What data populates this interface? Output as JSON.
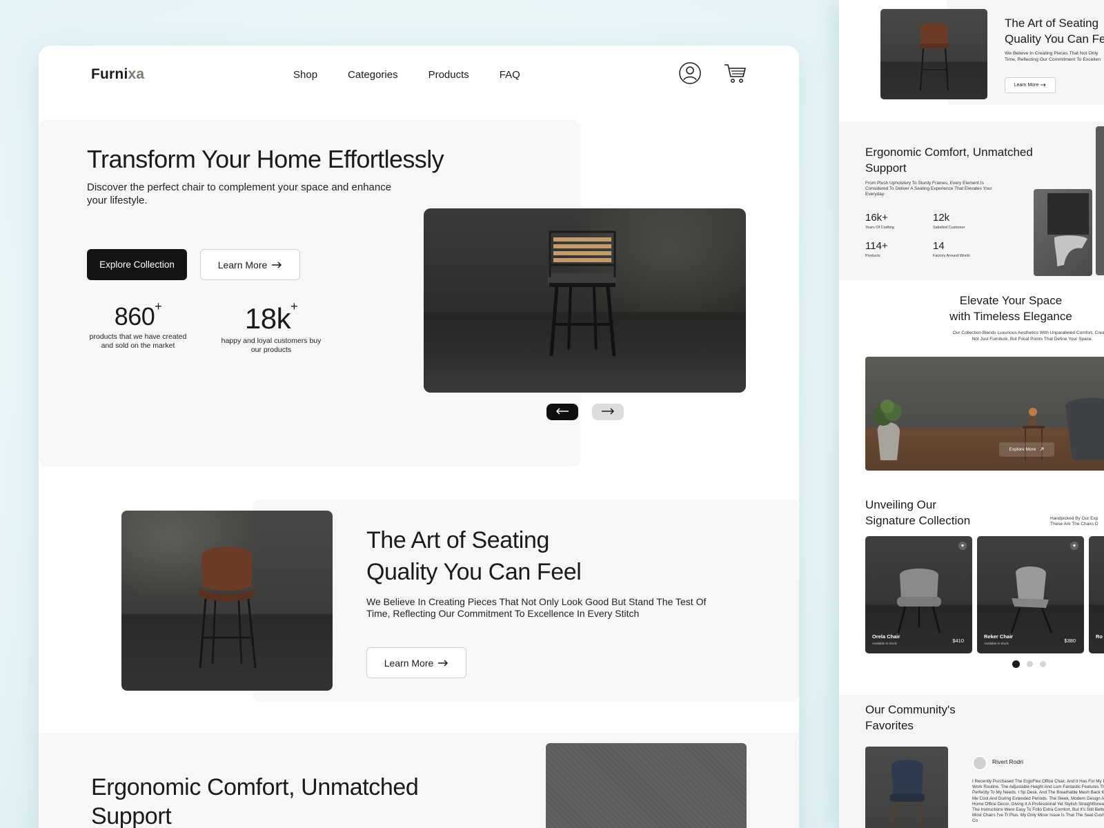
{
  "main": {
    "logo": {
      "part1": "Furni",
      "part2": "xa"
    },
    "nav": [
      "Shop",
      "Categories",
      "Products",
      "FAQ"
    ],
    "icons": {
      "user": "user-circle-icon",
      "cart": "shopping-cart-icon"
    },
    "hero": {
      "title": "Transform Your Home Effortlessly",
      "subtitle": "Discover the perfect chair to complement your space and enhance your lifestyle.",
      "primary_cta": "Explore Collection",
      "secondary_cta": "Learn More",
      "stats": [
        {
          "value": "860",
          "suffix": "+",
          "caption": "products that we have created and sold on the market"
        },
        {
          "value": "18k",
          "suffix": "+",
          "caption": "happy and loyal customers buy our products"
        }
      ]
    },
    "art": {
      "title_line1": "The Art of Seating",
      "title_line2": "Quality You Can Feel",
      "description": "We Believe In Creating Pieces That Not Only Look Good But Stand The Test Of Time, Reflecting Our Commitment To Excellence In Every Stitch",
      "cta": "Learn More"
    },
    "ergonomic": {
      "title_line1": "Ergonomic Comfort, Unmatched",
      "title_line2": "Support"
    }
  },
  "preview": {
    "top": {
      "title_line1": "The Art of Seating",
      "title_line2": "Quality You Can Fe",
      "desc_line1": "We Believe In Creating Pieces That Not Only",
      "desc_line2": "Time, Reflecting Our Commitment To Excellen",
      "cta": "Learn More"
    },
    "ergonomic": {
      "title": "Ergonomic Comfort, Unmatched Support",
      "description": "From Plush Upholstery To Sturdy Frames, Every Element Is Considered To Deliver A Seating Experience That Elevates Your Everyday.",
      "stats": [
        {
          "value": "16k+",
          "caption": "Years Of Crafting"
        },
        {
          "value": "12k",
          "caption": "Satisfied Customer"
        },
        {
          "value": "114+",
          "caption": "Products"
        },
        {
          "value": "14",
          "caption": "Factory Around World"
        }
      ]
    },
    "elevate": {
      "title_line1": "Elevate Your Space",
      "title_line2": "with Timeless Elegance",
      "desc_line1": "Our Collection Blends Luxurious Aesthetics With Unparalleled Comfort, Creating",
      "desc_line2": "Not Just Furniture, But Focal Points That Define Your Space.",
      "cta": "Explore More"
    },
    "signature": {
      "title_line1": "Unveiling Our",
      "title_line2": "Signature Collection",
      "note_line1": "Handpicked By Our Exp",
      "note_line2": "These Are The Chairs D",
      "cards": [
        {
          "name": "Orela Chair",
          "availability": "Available In Stock",
          "price": "$410"
        },
        {
          "name": "Reker Chair",
          "availability": "Available In Stock",
          "price": "$380"
        },
        {
          "name": "Ro",
          "availability": "",
          "price": ""
        }
      ],
      "active_dot": 0
    },
    "community": {
      "title_line1": "Our Community's",
      "title_line2": "Favorites",
      "user": "Rivert Rodri",
      "review": "I Recently Purchased The ErgoFlex Office Chair, And It Has For My Daily Work Routine. The Adjustable Height And Lum Fantastic Features That Cater Perfectly To My Needs. I Sp Desk, And The Breathable Mesh Back Keeps Me Cool And During Extended Periods. The Sleek, Modern Design Also I My Home Office Decor, Giving It A Professional Yet Stylish Straightforward, And The Instructions Were Easy To Follo Extra Comfort, But It's Still Better Than Most Chairs I've Tr Plus. My Only Minor Issue Is That The Seat Cushioning Co"
    }
  }
}
